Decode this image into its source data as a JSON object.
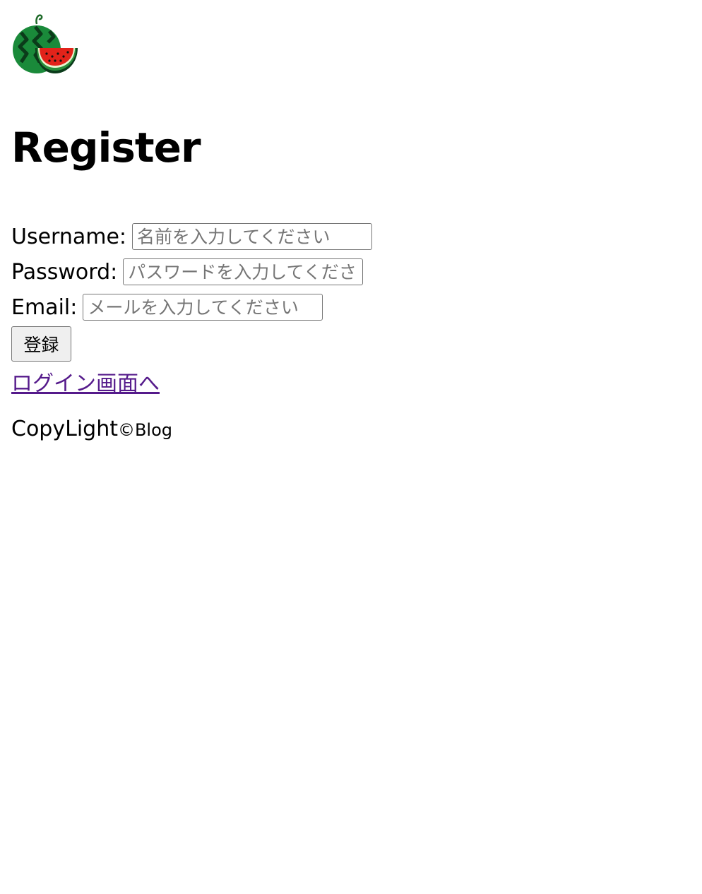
{
  "header": {
    "logo_icon": "watermelon-icon"
  },
  "page": {
    "title": "Register"
  },
  "form": {
    "username_label": "Username:",
    "username_placeholder": "名前を入力してください",
    "password_label": "Password:",
    "password_placeholder": "パスワードを入力してください",
    "email_label": "Email:",
    "email_placeholder": "メールを入力してください",
    "submit_label": "登録"
  },
  "links": {
    "login_label": "ログイン画面へ"
  },
  "footer": {
    "brand": "CopyLight",
    "suffix": "©Blog"
  },
  "colors": {
    "link_visited": "#551a8b",
    "button_bg": "#efefef",
    "input_border": "#767676",
    "watermelon_green": "#1a8a3a",
    "watermelon_red": "#e2231a"
  }
}
